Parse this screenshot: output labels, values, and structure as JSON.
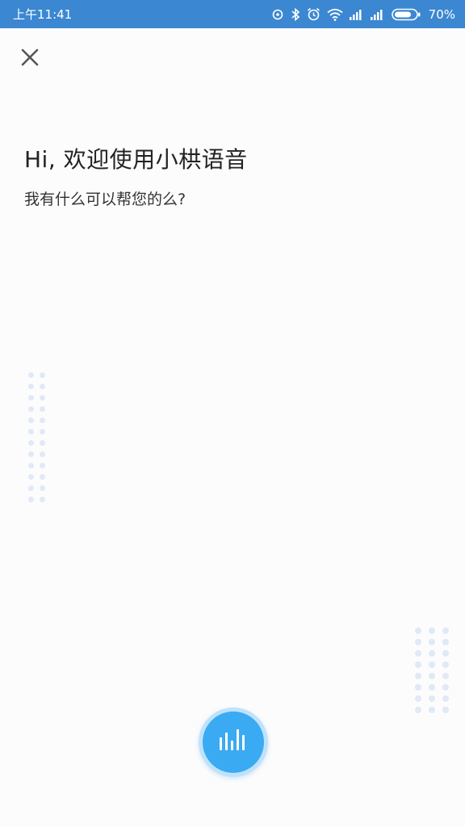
{
  "status_bar": {
    "time": "上午11:41",
    "battery_percent": "70%",
    "icons": [
      "sync-icon",
      "bluetooth-icon",
      "alarm-icon",
      "wifi-icon",
      "signal-icon",
      "signal-icon",
      "battery-icon"
    ],
    "background": "#3b87d1"
  },
  "header": {
    "close_icon": "close-icon"
  },
  "main": {
    "greeting": "Hi, 欢迎使用小栱语音",
    "prompt": "我有什么可以帮您的么?"
  },
  "voice_button": {
    "icon": "sound-wave-icon",
    "color": "#3aaaf3"
  }
}
